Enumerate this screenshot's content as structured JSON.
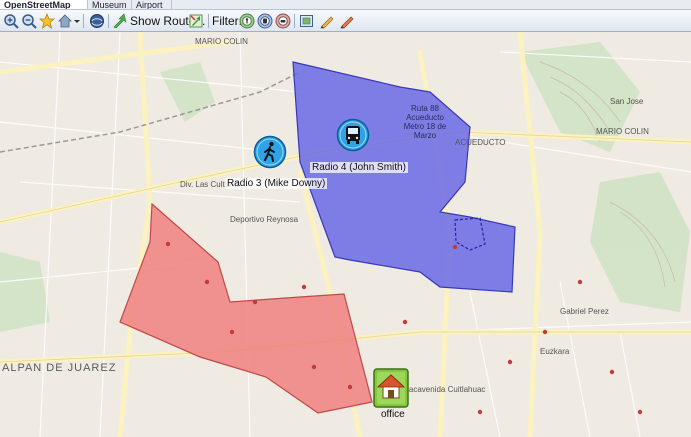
{
  "tabs": [
    {
      "label": "OpenStreetMap",
      "active": true
    },
    {
      "label": "Museum",
      "active": false
    },
    {
      "label": "Airport",
      "active": false
    }
  ],
  "toolbar": {
    "show_route_label": "Show Route...",
    "filter_label": "Filter:"
  },
  "map": {
    "colors": {
      "blue_zone": "#6a6ae6",
      "red_zone": "#f08080",
      "base": "#efeae2",
      "road": "#fffbea",
      "green": "#cfe3c6"
    },
    "markers": [
      {
        "name": "Radio 3 (Mike Downy)",
        "icon": "walker-icon"
      },
      {
        "name": "Radio 4 (John Smith)",
        "icon": "bus-icon"
      },
      {
        "name": "office",
        "icon": "home-icon"
      }
    ],
    "place_labels": {
      "alpan": "ALPAN DE JUAREZ",
      "ruta": "Ruta 88 Acueducto Metro 18 de Marzo",
      "acueducto": "ACUEDUCTO",
      "mario_colin": "MARIO COLIN",
      "san_jose": "San Jose",
      "cultura": "Div. Las Culturas",
      "deportivo": "Deportivo Reynosa",
      "huacavenida": "huacavenida Cuitlahuac",
      "euzkara": "Euzkara",
      "gabriel": "Gabriel Perez"
    }
  }
}
